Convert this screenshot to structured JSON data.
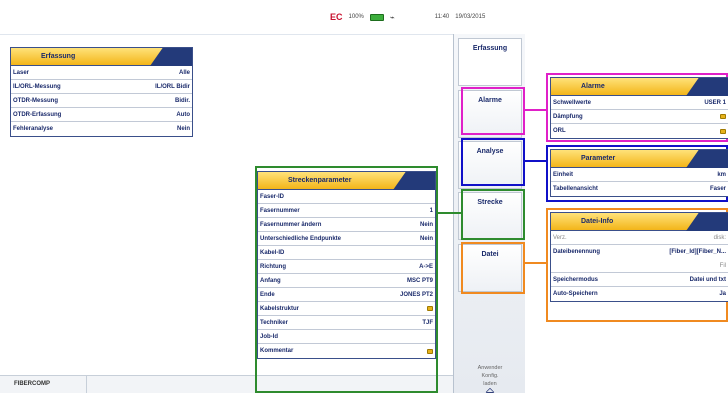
{
  "status": {
    "battery": "100%",
    "time": "11:40",
    "date": "19/03/2015",
    "ec_logo": "EC"
  },
  "bottom": {
    "logo": "FIBERCOMP"
  },
  "softkeys": {
    "items": [
      {
        "label": "Erfassung"
      },
      {
        "label": "Alarme"
      },
      {
        "label": "Analyse"
      },
      {
        "label": "Strecke"
      },
      {
        "label": "Datei"
      }
    ],
    "footer_lines": [
      "Anwender",
      "Konfig.",
      "laden"
    ]
  },
  "erfassung": {
    "title": "Erfassung",
    "rows": [
      {
        "label": "Laser",
        "value": "Alle"
      },
      {
        "label": "IL/ORL-Messung",
        "value": "IL/ORL Bidir"
      },
      {
        "label": "OTDR-Messung",
        "value": "Bidir."
      },
      {
        "label": "OTDR-Erfassung",
        "value": "Auto"
      },
      {
        "label": "Fehleranalyse",
        "value": "Nein"
      }
    ]
  },
  "strecke": {
    "title": "Streckenparameter",
    "rows": [
      {
        "label": "Faser-ID",
        "value": ""
      },
      {
        "label": "Fasernummer",
        "value": "1"
      },
      {
        "label": "Fasernummer ändern",
        "value": "Nein"
      },
      {
        "label": "Unterschiedliche Endpunkte",
        "value": "Nein"
      },
      {
        "label": "Kabel-ID",
        "value": ""
      },
      {
        "label": "Richtung",
        "value": "A->E"
      },
      {
        "label": "Anfang",
        "value": "MSC PT9"
      },
      {
        "label": "Ende",
        "value": "JONES PT2"
      },
      {
        "label": "Kabelstruktur",
        "value": "key"
      },
      {
        "label": "Techniker",
        "value": "TJF"
      },
      {
        "label": "Job-Id",
        "value": ""
      },
      {
        "label": "Kommentar",
        "value": "key"
      }
    ]
  },
  "alarme": {
    "title": "Alarme",
    "rows": [
      {
        "label": "Schwellwerte",
        "value": "USER 1"
      },
      {
        "label": "Dämpfung",
        "value": "key"
      },
      {
        "label": "ORL",
        "value": "key"
      }
    ]
  },
  "parameter": {
    "title": "Parameter",
    "rows": [
      {
        "label": "Einheit",
        "value": "km"
      },
      {
        "label": "Tabellenansicht",
        "value": "Faser"
      }
    ]
  },
  "datei": {
    "title": "Datei-Info",
    "rows": [
      {
        "label": "Verz.",
        "value": "disk:"
      },
      {
        "label": "Dateibenennung",
        "value": "[Fiber_Id][Fiber_N..."
      },
      {
        "label": "",
        "value": "Fil"
      },
      {
        "label": "Speichermodus",
        "value": "Datei und txt"
      },
      {
        "label": "Auto-Speichern",
        "value": "Ja"
      }
    ]
  },
  "colors": {
    "magenta": "#e020c8",
    "blue": "#1010c8",
    "green": "#2e8b2e",
    "orange": "#f08a20",
    "navy": "#1a2a6b",
    "header_gold": "#f3b519"
  }
}
